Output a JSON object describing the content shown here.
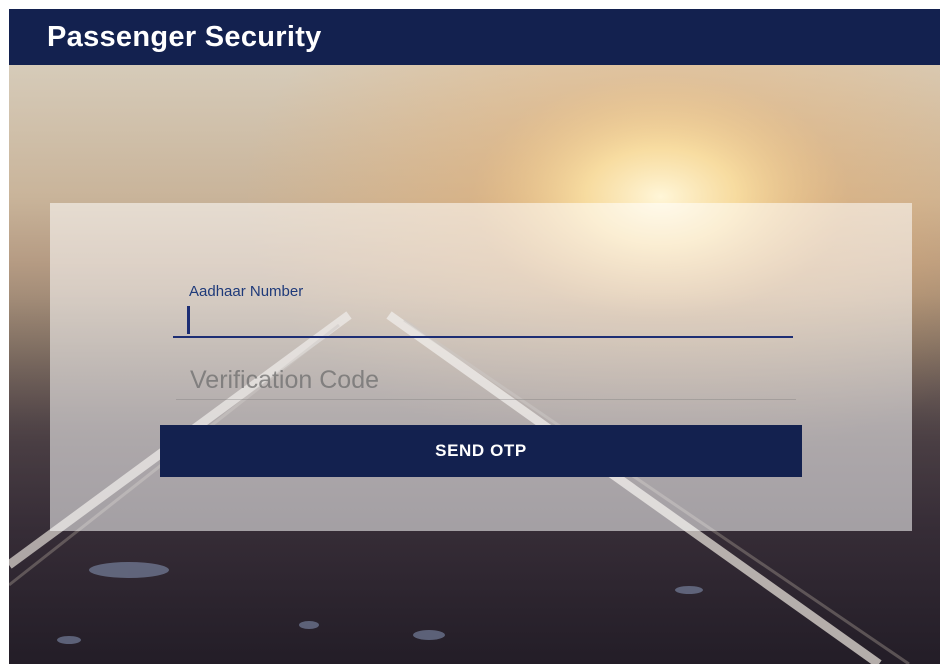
{
  "app_bar": {
    "title": "Passenger Security",
    "color": "#13214f"
  },
  "login_form": {
    "aadhaar_label": "Aadhaar Number",
    "aadhaar_value": "",
    "verification_placeholder": "Verification Code",
    "verification_value": "",
    "send_button_label": "SEND OTP",
    "button_color": "#13214f"
  },
  "background": {
    "description_icon": "railway-track-sunset-image"
  }
}
